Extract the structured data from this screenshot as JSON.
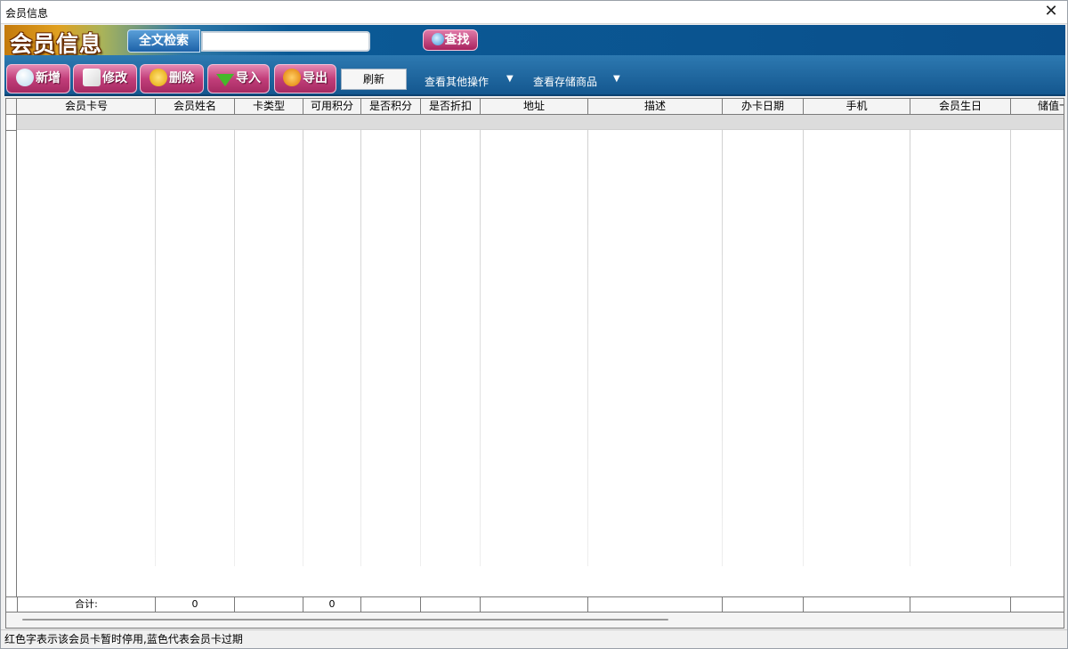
{
  "window": {
    "title": "会员信息"
  },
  "header": {
    "logo_text": "会员信息",
    "search_label": "全文检索",
    "search_value": "",
    "find_label": "查找"
  },
  "toolbar": {
    "add_label": "新增",
    "edit_label": "修改",
    "delete_label": "删除",
    "import_label": "导入",
    "export_label": "导出",
    "refresh_label": "刷新",
    "other_ops_label": "查看其他操作",
    "stored_goods_label": "查看存储商品"
  },
  "grid": {
    "columns": [
      "会员卡号",
      "会员姓名",
      "卡类型",
      "可用积分",
      "是否积分",
      "是否折扣",
      "地址",
      "描述",
      "办卡日期",
      "手机",
      "会员生日",
      "储值卡"
    ],
    "footer": {
      "total_label": "合计:",
      "name_total": "0",
      "points_total": "0"
    }
  },
  "status": {
    "text": "红色字表示该会员卡暂时停用,蓝色代表会员卡过期"
  },
  "colors": {
    "header_blue": "#0a4f8b",
    "button_pink": "#c23e7a",
    "toolbar_blue": "#14578f"
  }
}
